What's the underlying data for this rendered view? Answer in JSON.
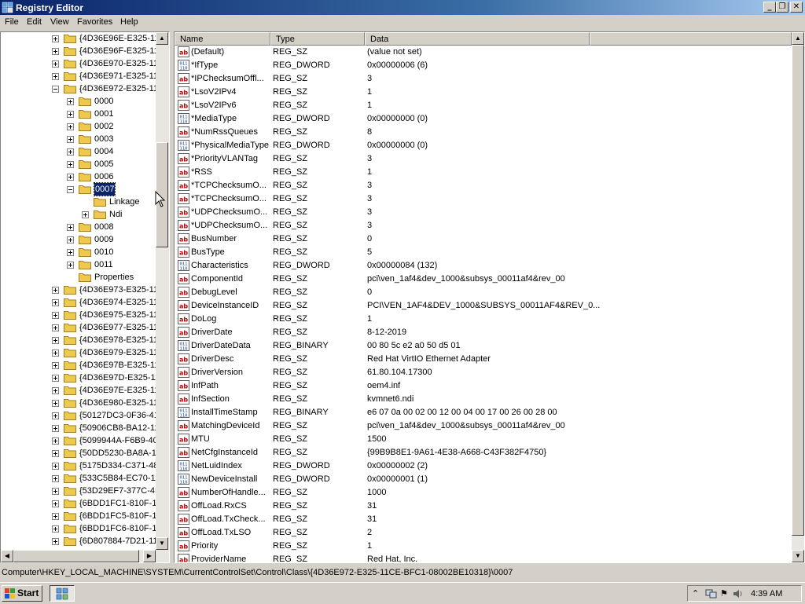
{
  "window": {
    "title": "Registry Editor"
  },
  "menu": [
    "File",
    "Edit",
    "View",
    "Favorites",
    "Help"
  ],
  "tree": [
    {
      "label": "{4D36E96E-E325-11",
      "level": 0,
      "expander": "plus"
    },
    {
      "label": "{4D36E96F-E325-11",
      "level": 0,
      "expander": "plus"
    },
    {
      "label": "{4D36E970-E325-11",
      "level": 0,
      "expander": "plus"
    },
    {
      "label": "{4D36E971-E325-11",
      "level": 0,
      "expander": "plus"
    },
    {
      "label": "{4D36E972-E325-11",
      "level": 0,
      "expander": "minus"
    },
    {
      "label": "0000",
      "level": 1,
      "expander": "plus"
    },
    {
      "label": "0001",
      "level": 1,
      "expander": "plus"
    },
    {
      "label": "0002",
      "level": 1,
      "expander": "plus"
    },
    {
      "label": "0003",
      "level": 1,
      "expander": "plus"
    },
    {
      "label": "0004",
      "level": 1,
      "expander": "plus"
    },
    {
      "label": "0005",
      "level": 1,
      "expander": "plus"
    },
    {
      "label": "0006",
      "level": 1,
      "expander": "plus"
    },
    {
      "label": "0007",
      "level": 1,
      "expander": "minus",
      "selected": true
    },
    {
      "label": "Linkage",
      "level": 2,
      "expander": "none"
    },
    {
      "label": "Ndi",
      "level": 2,
      "expander": "plus"
    },
    {
      "label": "0008",
      "level": 1,
      "expander": "plus"
    },
    {
      "label": "0009",
      "level": 1,
      "expander": "plus"
    },
    {
      "label": "0010",
      "level": 1,
      "expander": "plus"
    },
    {
      "label": "0011",
      "level": 1,
      "expander": "plus"
    },
    {
      "label": "Properties",
      "level": 1,
      "expander": "none"
    },
    {
      "label": "{4D36E973-E325-11",
      "level": 0,
      "expander": "plus"
    },
    {
      "label": "{4D36E974-E325-11",
      "level": 0,
      "expander": "plus"
    },
    {
      "label": "{4D36E975-E325-11",
      "level": 0,
      "expander": "plus"
    },
    {
      "label": "{4D36E977-E325-11",
      "level": 0,
      "expander": "plus"
    },
    {
      "label": "{4D36E978-E325-11",
      "level": 0,
      "expander": "plus"
    },
    {
      "label": "{4D36E979-E325-11",
      "level": 0,
      "expander": "plus"
    },
    {
      "label": "{4D36E97B-E325-11",
      "level": 0,
      "expander": "plus"
    },
    {
      "label": "{4D36E97D-E325-11",
      "level": 0,
      "expander": "plus"
    },
    {
      "label": "{4D36E97E-E325-11",
      "level": 0,
      "expander": "plus"
    },
    {
      "label": "{4D36E980-E325-11",
      "level": 0,
      "expander": "plus"
    },
    {
      "label": "{50127DC3-0F36-41",
      "level": 0,
      "expander": "plus"
    },
    {
      "label": "{50906CB8-BA12-11",
      "level": 0,
      "expander": "plus"
    },
    {
      "label": "{5099944A-F6B9-40",
      "level": 0,
      "expander": "plus"
    },
    {
      "label": "{50DD5230-BA8A-1",
      "level": 0,
      "expander": "plus"
    },
    {
      "label": "{5175D334-C371-48",
      "level": 0,
      "expander": "plus"
    },
    {
      "label": "{533C5B84-EC70-11",
      "level": 0,
      "expander": "plus"
    },
    {
      "label": "{53D29EF7-377C-4D",
      "level": 0,
      "expander": "plus"
    },
    {
      "label": "{6BDD1FC1-810F-11",
      "level": 0,
      "expander": "plus"
    },
    {
      "label": "{6BDD1FC5-810F-11",
      "level": 0,
      "expander": "plus"
    },
    {
      "label": "{6BDD1FC6-810F-11",
      "level": 0,
      "expander": "plus"
    },
    {
      "label": "{6D807884-7D21-11",
      "level": 0,
      "expander": "plus"
    }
  ],
  "columns": {
    "name": "Name",
    "type": "Type",
    "data": "Data"
  },
  "values": [
    {
      "name": "(Default)",
      "type": "REG_SZ",
      "data": "(value not set)",
      "icon": "string"
    },
    {
      "name": "*IfType",
      "type": "REG_DWORD",
      "data": "0x00000006 (6)",
      "icon": "binary"
    },
    {
      "name": "*IPChecksumOffl...",
      "type": "REG_SZ",
      "data": "3",
      "icon": "string"
    },
    {
      "name": "*LsoV2IPv4",
      "type": "REG_SZ",
      "data": "1",
      "icon": "string"
    },
    {
      "name": "*LsoV2IPv6",
      "type": "REG_SZ",
      "data": "1",
      "icon": "string"
    },
    {
      "name": "*MediaType",
      "type": "REG_DWORD",
      "data": "0x00000000 (0)",
      "icon": "binary"
    },
    {
      "name": "*NumRssQueues",
      "type": "REG_SZ",
      "data": "8",
      "icon": "string"
    },
    {
      "name": "*PhysicalMediaType",
      "type": "REG_DWORD",
      "data": "0x00000000 (0)",
      "icon": "binary"
    },
    {
      "name": "*PriorityVLANTag",
      "type": "REG_SZ",
      "data": "3",
      "icon": "string"
    },
    {
      "name": "*RSS",
      "type": "REG_SZ",
      "data": "1",
      "icon": "string"
    },
    {
      "name": "*TCPChecksumO...",
      "type": "REG_SZ",
      "data": "3",
      "icon": "string"
    },
    {
      "name": "*TCPChecksumO...",
      "type": "REG_SZ",
      "data": "3",
      "icon": "string"
    },
    {
      "name": "*UDPChecksumO...",
      "type": "REG_SZ",
      "data": "3",
      "icon": "string"
    },
    {
      "name": "*UDPChecksumO...",
      "type": "REG_SZ",
      "data": "3",
      "icon": "string"
    },
    {
      "name": "BusNumber",
      "type": "REG_SZ",
      "data": "0",
      "icon": "string"
    },
    {
      "name": "BusType",
      "type": "REG_SZ",
      "data": "5",
      "icon": "string"
    },
    {
      "name": "Characteristics",
      "type": "REG_DWORD",
      "data": "0x00000084 (132)",
      "icon": "binary"
    },
    {
      "name": "ComponentId",
      "type": "REG_SZ",
      "data": "pci\\ven_1af4&dev_1000&subsys_00011af4&rev_00",
      "icon": "string"
    },
    {
      "name": "DebugLevel",
      "type": "REG_SZ",
      "data": "0",
      "icon": "string"
    },
    {
      "name": "DeviceInstanceID",
      "type": "REG_SZ",
      "data": "PCI\\VEN_1AF4&DEV_1000&SUBSYS_00011AF4&REV_0...",
      "icon": "string"
    },
    {
      "name": "DoLog",
      "type": "REG_SZ",
      "data": "1",
      "icon": "string"
    },
    {
      "name": "DriverDate",
      "type": "REG_SZ",
      "data": "8-12-2019",
      "icon": "string"
    },
    {
      "name": "DriverDateData",
      "type": "REG_BINARY",
      "data": "00 80 5c e2 a0 50 d5 01",
      "icon": "binary"
    },
    {
      "name": "DriverDesc",
      "type": "REG_SZ",
      "data": "Red Hat VirtIO Ethernet Adapter",
      "icon": "string"
    },
    {
      "name": "DriverVersion",
      "type": "REG_SZ",
      "data": "61.80.104.17300",
      "icon": "string"
    },
    {
      "name": "InfPath",
      "type": "REG_SZ",
      "data": "oem4.inf",
      "icon": "string"
    },
    {
      "name": "InfSection",
      "type": "REG_SZ",
      "data": "kvmnet6.ndi",
      "icon": "string"
    },
    {
      "name": "InstallTimeStamp",
      "type": "REG_BINARY",
      "data": "e6 07 0a 00 02 00 12 00 04 00 17 00 26 00 28 00",
      "icon": "binary"
    },
    {
      "name": "MatchingDeviceId",
      "type": "REG_SZ",
      "data": "pci\\ven_1af4&dev_1000&subsys_00011af4&rev_00",
      "icon": "string"
    },
    {
      "name": "MTU",
      "type": "REG_SZ",
      "data": "1500",
      "icon": "string"
    },
    {
      "name": "NetCfgInstanceId",
      "type": "REG_SZ",
      "data": "{99B9B8E1-9A61-4E38-A668-C43F382F4750}",
      "icon": "string"
    },
    {
      "name": "NetLuidIndex",
      "type": "REG_DWORD",
      "data": "0x00000002 (2)",
      "icon": "binary"
    },
    {
      "name": "NewDeviceInstall",
      "type": "REG_DWORD",
      "data": "0x00000001 (1)",
      "icon": "binary"
    },
    {
      "name": "NumberOfHandle...",
      "type": "REG_SZ",
      "data": "1000",
      "icon": "string"
    },
    {
      "name": "OffLoad.RxCS",
      "type": "REG_SZ",
      "data": "31",
      "icon": "string"
    },
    {
      "name": "OffLoad.TxCheck...",
      "type": "REG_SZ",
      "data": "31",
      "icon": "string"
    },
    {
      "name": "OffLoad.TxLSO",
      "type": "REG_SZ",
      "data": "2",
      "icon": "string"
    },
    {
      "name": "Priority",
      "type": "REG_SZ",
      "data": "1",
      "icon": "string"
    },
    {
      "name": "ProviderName",
      "type": "REG_SZ",
      "data": "Red Hat, Inc.",
      "icon": "string"
    }
  ],
  "status": {
    "path": "Computer\\HKEY_LOCAL_MACHINE\\SYSTEM\\CurrentControlSet\\Control\\Class\\{4D36E972-E325-11CE-BFC1-08002BE10318}\\0007"
  },
  "taskbar": {
    "start": "Start",
    "clock": "4:39 AM"
  },
  "colors": {
    "titlebar": "#0a246a",
    "selection": "#0a246a",
    "folder": "#f0c850",
    "string_icon": "#c00000",
    "binary_icon": "#1040a0"
  }
}
